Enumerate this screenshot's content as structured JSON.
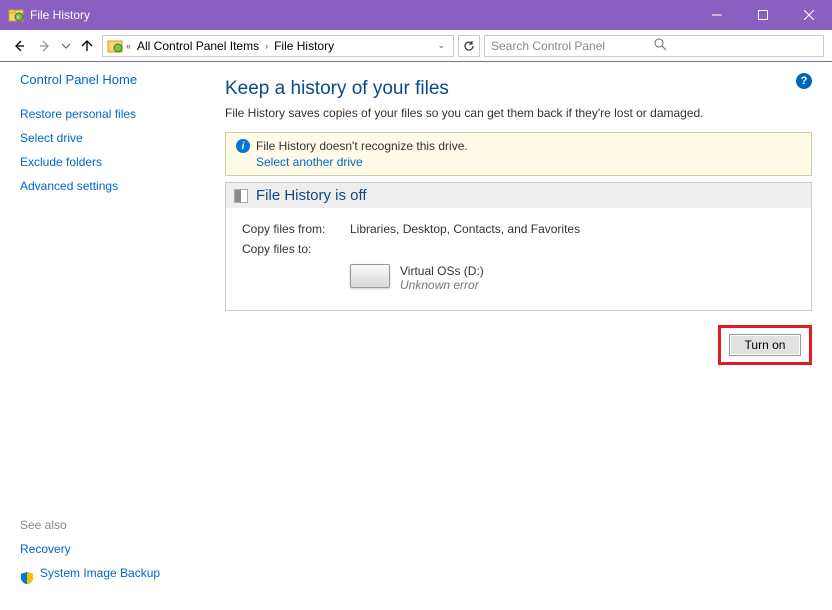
{
  "window": {
    "title": "File History"
  },
  "nav": {
    "breadcrumbs": {
      "root_marker": "«",
      "a": "All Control Panel Items",
      "b": "File History"
    },
    "search_placeholder": "Search Control Panel"
  },
  "sidebar": {
    "home": "Control Panel Home",
    "links": {
      "restore": "Restore personal files",
      "select_drive": "Select drive",
      "exclude": "Exclude folders",
      "advanced": "Advanced settings"
    }
  },
  "seealso": {
    "heading": "See also",
    "links": {
      "recovery": "Recovery",
      "sib": "System Image Backup"
    }
  },
  "main": {
    "heading": "Keep a history of your files",
    "description": "File History saves copies of your files so you can get them back if they're lost or damaged.",
    "warning": {
      "text": "File History doesn't recognize this drive.",
      "link": "Select another drive"
    },
    "status": {
      "title": "File History is off",
      "copy_from_label": "Copy files from:",
      "copy_from_value": "Libraries, Desktop, Contacts, and Favorites",
      "copy_to_label": "Copy files to:",
      "drive_name": "Virtual OSs (D:)",
      "drive_error": "Unknown error"
    },
    "button": "Turn on"
  }
}
